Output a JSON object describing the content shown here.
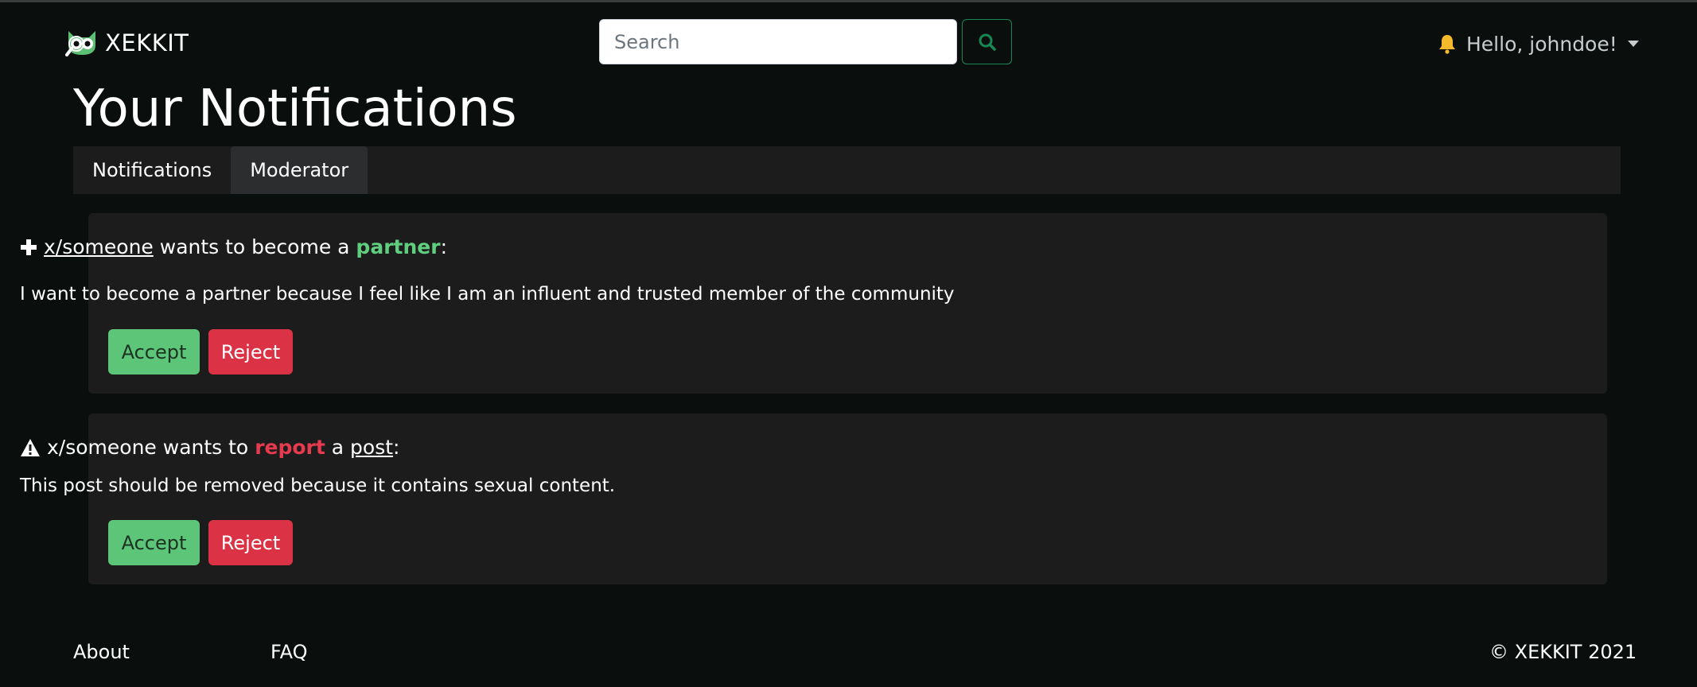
{
  "colors": {
    "background": "#0a0f0e",
    "card": "#1c1c1d",
    "accept": "#5cc577",
    "reject": "#dc3245",
    "highlight_green": "#5fce7e",
    "highlight_red": "#e63b4e",
    "search_button_border": "#198754",
    "bell": "#f5b92c"
  },
  "navbar": {
    "brand": "XEKKIT",
    "logo_icon": "owl-magnifier-logo",
    "search": {
      "placeholder": "Search",
      "value": "",
      "button_icon": "search-icon"
    },
    "user": {
      "bell_icon": "bell-icon",
      "greeting": "Hello, johndoe!",
      "caret_icon": "caret-down-icon"
    }
  },
  "page": {
    "title": "Your Notifications"
  },
  "tabs": [
    {
      "label": "Notifications",
      "active": false
    },
    {
      "label": "Moderator",
      "active": true
    }
  ],
  "requests": [
    {
      "icon": "plus-icon",
      "user_link": "x/someone",
      "text_middle": " wants to become a ",
      "keyword": "partner",
      "suffix": ":",
      "message": "I want to become a partner because I feel like I am an influent and trusted member of the community",
      "accept_label": "Accept",
      "reject_label": "Reject"
    },
    {
      "icon": "warning-triangle-icon",
      "user_text": "x/someone",
      "text_middle": " wants to ",
      "keyword": "report",
      "text_after": " a ",
      "post_link": "post",
      "suffix": ":",
      "message": "This post should be removed because it contains sexual content.",
      "accept_label": "Accept",
      "reject_label": "Reject"
    }
  ],
  "footer": {
    "about": "About",
    "faq": "FAQ",
    "copyright": "© XEKKIT 2021"
  }
}
